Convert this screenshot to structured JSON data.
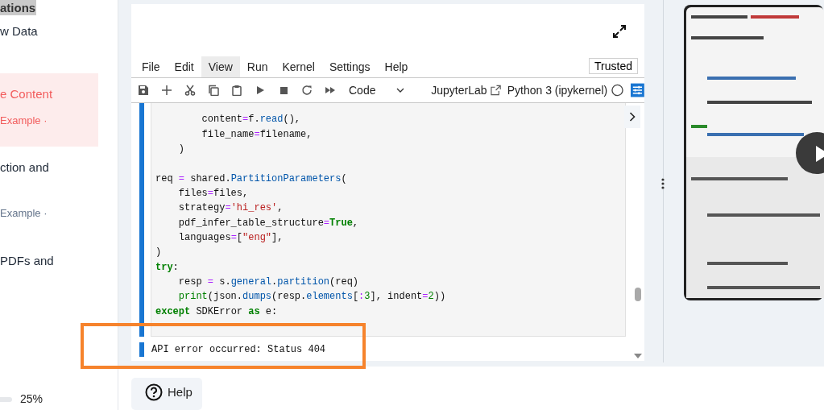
{
  "sidebar": {
    "heading": "ations",
    "items": [
      {
        "title": "w Data",
        "selected": false
      },
      {
        "title": "e Content",
        "subtitle": "Example ·",
        "selected": true
      },
      {
        "title": "ction and",
        "subtitle": "Example ·",
        "selected": false
      },
      {
        "title": "PDFs and",
        "selected": false
      }
    ],
    "progress_reading": "25%"
  },
  "notebook": {
    "menu": [
      {
        "label": "File",
        "selected": false
      },
      {
        "label": "Edit",
        "selected": false
      },
      {
        "label": "View",
        "selected": true
      },
      {
        "label": "Run",
        "selected": false
      },
      {
        "label": "Kernel",
        "selected": false
      },
      {
        "label": "Settings",
        "selected": false
      },
      {
        "label": "Help",
        "selected": false
      }
    ],
    "trusted": "Trusted",
    "cell_type": "Code",
    "launcher": "JupyterLab",
    "kernel": "Python 3 (ipykernel)",
    "code": [
      {
        "tokens": [
          {
            "t": "        content",
            "kind": "p"
          },
          {
            "t": "=",
            "kind": "op"
          },
          {
            "t": "f.",
            "kind": "p"
          },
          {
            "t": "read",
            "kind": "fn"
          },
          {
            "t": "(),",
            "kind": "p"
          }
        ]
      },
      {
        "tokens": [
          {
            "t": "        file_name",
            "kind": "p"
          },
          {
            "t": "=",
            "kind": "op"
          },
          {
            "t": "filename,",
            "kind": "p"
          }
        ]
      },
      {
        "tokens": [
          {
            "t": "    )",
            "kind": "p"
          }
        ]
      },
      {
        "blank_before": true,
        "tokens": [
          {
            "t": "req ",
            "kind": "p"
          },
          {
            "t": "=",
            "kind": "op"
          },
          {
            "t": " shared.",
            "kind": "p"
          },
          {
            "t": "PartitionParameters",
            "kind": "fn"
          },
          {
            "t": "(",
            "kind": "p"
          }
        ]
      },
      {
        "tokens": [
          {
            "t": "    files",
            "kind": "p"
          },
          {
            "t": "=",
            "kind": "op"
          },
          {
            "t": "files,",
            "kind": "p"
          }
        ]
      },
      {
        "tokens": [
          {
            "t": "    strategy",
            "kind": "p"
          },
          {
            "t": "=",
            "kind": "op"
          },
          {
            "t": "'hi_res'",
            "kind": "str"
          },
          {
            "t": ",",
            "kind": "p"
          }
        ]
      },
      {
        "tokens": [
          {
            "t": "    pdf_infer_table_structure",
            "kind": "p"
          },
          {
            "t": "=",
            "kind": "op"
          },
          {
            "t": "True",
            "kind": "kw"
          },
          {
            "t": ",",
            "kind": "p"
          }
        ]
      },
      {
        "tokens": [
          {
            "t": "    languages",
            "kind": "p"
          },
          {
            "t": "=",
            "kind": "op"
          },
          {
            "t": "[",
            "kind": "p"
          },
          {
            "t": "\"eng\"",
            "kind": "str"
          },
          {
            "t": "],",
            "kind": "p"
          }
        ]
      },
      {
        "tokens": [
          {
            "t": ")",
            "kind": "p"
          }
        ]
      },
      {
        "tokens": [
          {
            "t": "try",
            "kind": "kw"
          },
          {
            "t": ":",
            "kind": "p"
          }
        ]
      },
      {
        "tokens": [
          {
            "t": "    resp ",
            "kind": "p"
          },
          {
            "t": "=",
            "kind": "op"
          },
          {
            "t": " s.",
            "kind": "p"
          },
          {
            "t": "general",
            "kind": "fn"
          },
          {
            "t": ".",
            "kind": "p"
          },
          {
            "t": "partition",
            "kind": "fn"
          },
          {
            "t": "(req)",
            "kind": "p"
          }
        ]
      },
      {
        "tokens": [
          {
            "t": "    print",
            "kind": "bi"
          },
          {
            "t": "(json.",
            "kind": "p"
          },
          {
            "t": "dumps",
            "kind": "fn"
          },
          {
            "t": "(resp.",
            "kind": "p"
          },
          {
            "t": "elements",
            "kind": "fn"
          },
          {
            "t": "[",
            "kind": "p"
          },
          {
            "t": ":",
            "kind": "op"
          },
          {
            "t": "3",
            "kind": "num"
          },
          {
            "t": "], indent",
            "kind": "p"
          },
          {
            "t": "=",
            "kind": "op"
          },
          {
            "t": "2",
            "kind": "num"
          },
          {
            "t": "))",
            "kind": "p"
          }
        ]
      },
      {
        "tokens": [
          {
            "t": "except",
            "kind": "kw"
          },
          {
            "t": " SDKError ",
            "kind": "p"
          },
          {
            "t": "as",
            "kind": "kw"
          },
          {
            "t": " e:",
            "kind": "p"
          }
        ]
      }
    ],
    "output": "API error occurred: Status 404"
  },
  "help": "Help"
}
